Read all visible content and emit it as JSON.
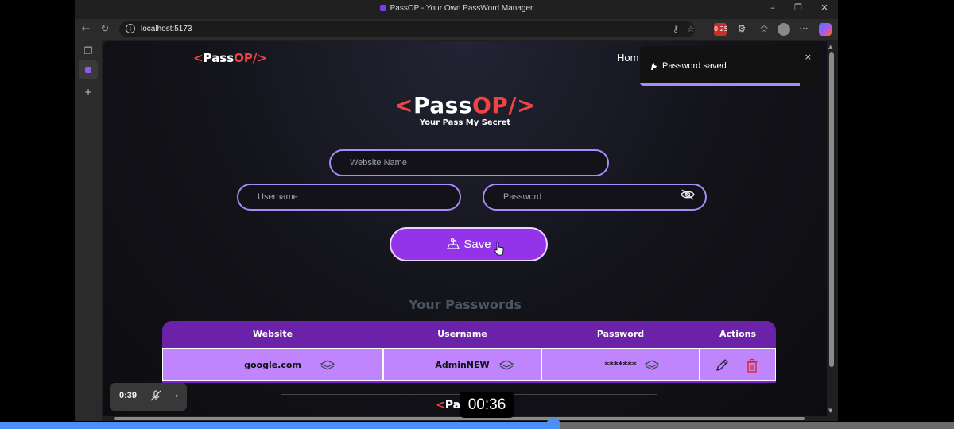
{
  "window": {
    "title": "PassOP - Your Own PassWord Manager",
    "controls": [
      "–",
      "❐",
      "✕"
    ]
  },
  "addressbar": {
    "url": "localhost:5173",
    "extension_badge": "0.25"
  },
  "app": {
    "logo_lt": "<",
    "logo_pass": "Pass",
    "logo_op": "OP/>",
    "nav_home": "Hom",
    "tagline": "Your Pass My Secret",
    "website_placeholder": "Website Name",
    "username_placeholder": "Username",
    "password_placeholder": "Password",
    "save_label": "Save",
    "section_title": "Your Passwords",
    "table": {
      "headers": [
        "Website",
        "Username",
        "Password",
        "Actions"
      ],
      "rows": [
        {
          "website": "google.com",
          "username": "AdminNEW",
          "password": "*******"
        }
      ]
    },
    "footer_logo_lt": "<",
    "footer_logo_text": "Pa"
  },
  "toast": {
    "message": "Password saved",
    "close": "×",
    "progress_fraction": 0.9
  },
  "video": {
    "elapsed_label": "0:39",
    "timestamp": "00:36",
    "progress_fraction": 0.58
  },
  "colors": {
    "accent": "#9333ea",
    "brand_red": "#ef4444",
    "table_header": "#6b21a8",
    "table_row": "#c084fc",
    "video_progress": "#4d8ff5"
  },
  "icons": {
    "copy": "copy-icon",
    "edit": "edit-icon",
    "delete": "delete-icon",
    "eye_slash": "eye-slash-icon"
  }
}
